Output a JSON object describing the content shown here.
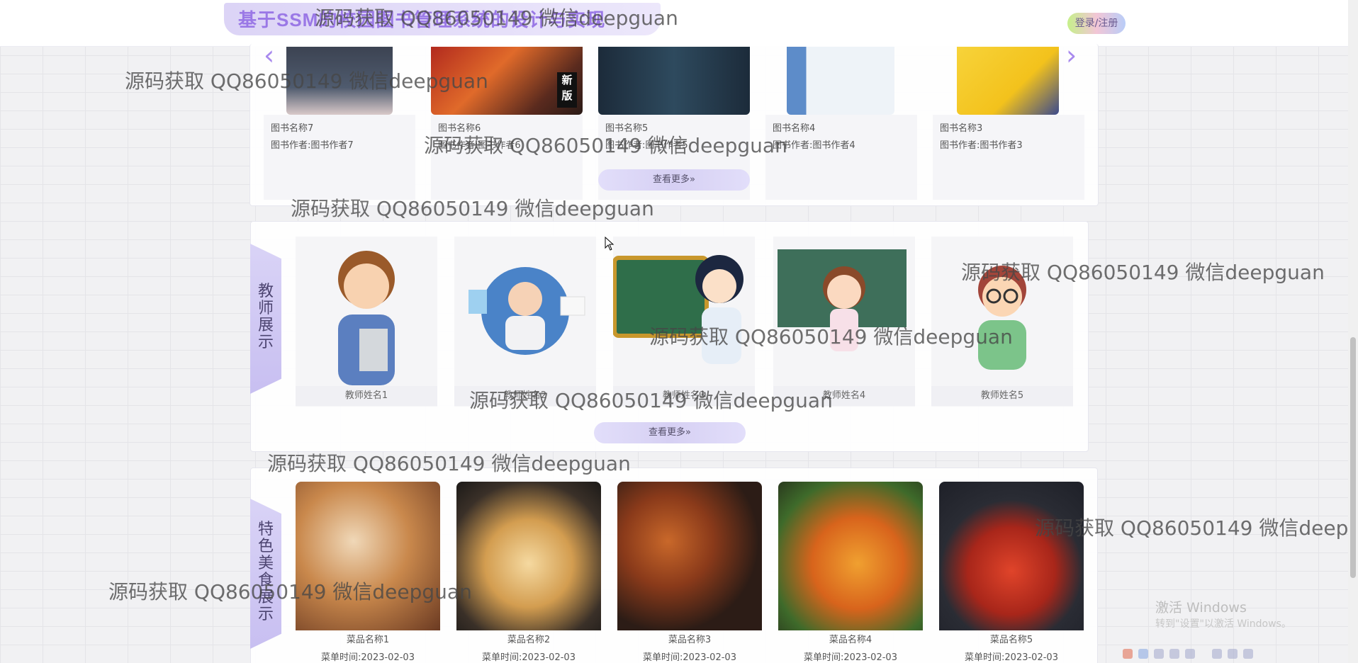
{
  "header": {
    "title": "基于SSM的校园图书管理系统的设计与实现",
    "login_label": "登录/注册"
  },
  "books": {
    "prev_icon": "chevron-left-icon",
    "next_icon": "chevron-right-icon",
    "items": [
      {
        "name": "图书名称7",
        "author": "图书作者:图书作者7"
      },
      {
        "name": "图书名称6",
        "author": "图书作者:图书作者6",
        "badge": "新版"
      },
      {
        "name": "图书名称5",
        "author": "图书作者:图书作者5"
      },
      {
        "name": "图书名称4",
        "author": "图书作者:图书作者4"
      },
      {
        "name": "图书名称3",
        "author": "图书作者:图书作者3"
      }
    ],
    "more_label": "查看更多»"
  },
  "teachers": {
    "section_label": "教师展示",
    "items": [
      {
        "name": "教师姓名1"
      },
      {
        "name": "教师姓名2"
      },
      {
        "name": "教师姓名3"
      },
      {
        "name": "教师姓名4"
      },
      {
        "name": "教师姓名5"
      }
    ],
    "more_label": "查看更多»"
  },
  "food": {
    "section_label": "特色美食展示",
    "items": [
      {
        "name": "菜品名称1",
        "time": "菜单时间:2023-02-03"
      },
      {
        "name": "菜品名称2",
        "time": "菜单时间:2023-02-03"
      },
      {
        "name": "菜品名称3",
        "time": "菜单时间:2023-02-03"
      },
      {
        "name": "菜品名称4",
        "time": "菜单时间:2023-02-03"
      },
      {
        "name": "菜品名称5",
        "time": "菜单时间:2023-02-03"
      }
    ]
  },
  "watermark_text": "源码获取 QQ86050149 微信deepguan",
  "windows": {
    "activate_title": "激活 Windows",
    "activate_sub": "转到\"设置\"以激活 Windows。"
  },
  "colors": {
    "accent": "#9a78e6",
    "panel_label_bg": "#d9d3f6"
  }
}
